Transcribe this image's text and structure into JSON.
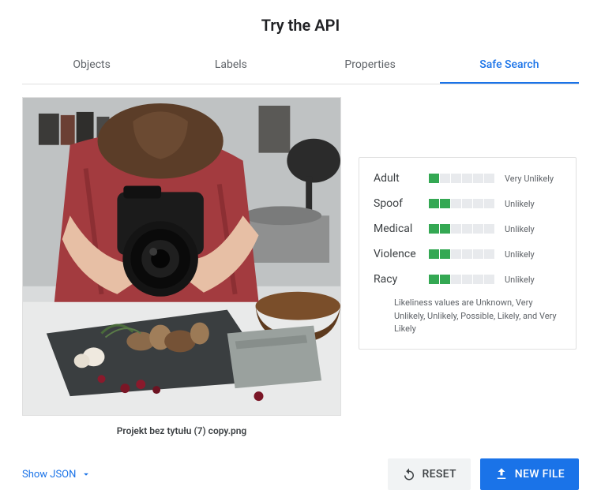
{
  "title": "Try the API",
  "tabs": [
    {
      "label": "Objects",
      "active": false
    },
    {
      "label": "Labels",
      "active": false
    },
    {
      "label": "Properties",
      "active": false
    },
    {
      "label": "Safe Search",
      "active": true
    }
  ],
  "filename": "Projekt bez tytułu (7) copy.png",
  "safe_search": {
    "items": [
      {
        "category": "Adult",
        "level": 1,
        "likelihood": "Very Unlikely"
      },
      {
        "category": "Spoof",
        "level": 2,
        "likelihood": "Unlikely"
      },
      {
        "category": "Medical",
        "level": 2,
        "likelihood": "Unlikely"
      },
      {
        "category": "Violence",
        "level": 2,
        "likelihood": "Unlikely"
      },
      {
        "category": "Racy",
        "level": 2,
        "likelihood": "Unlikely"
      }
    ],
    "segment_count": 6,
    "caption": "Likeliness values are Unknown, Very Unlikely, Unlikely, Possible, Likely, and Very Likely",
    "fill_color": "#34a853"
  },
  "footer": {
    "show_json": "Show JSON",
    "reset": "RESET",
    "new_file": "NEW FILE"
  }
}
